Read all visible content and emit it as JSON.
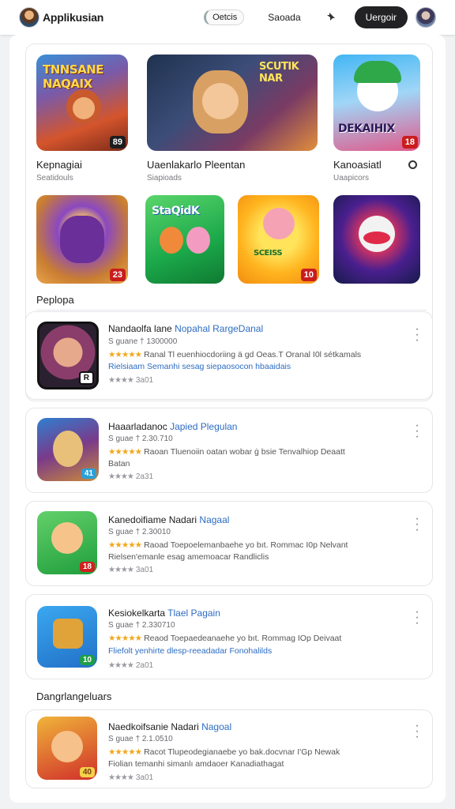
{
  "header": {
    "app_name": "Applikusian",
    "pill_label": "Oetcis",
    "link_label": "Saoada",
    "pin_icon": "pin-icon",
    "primary_label": "Uergoir"
  },
  "grid": {
    "row1": [
      {
        "title": "Kepnagiai",
        "subtitle": "Seatidouls",
        "badge": "89",
        "art_text": "TNNSANE NAQAIX"
      },
      {
        "title": "Uaenlakarlo Pleentan",
        "subtitle": "Siapioads",
        "badge": "",
        "art_text": "SCUTIK NAR"
      },
      {
        "title": "Kanoasiatl",
        "subtitle": "Uaapicors",
        "badge": "18",
        "art_text": "DEKAIHIX"
      }
    ],
    "row2_badges": [
      "23",
      "",
      "10",
      ""
    ],
    "row2_art": [
      "",
      "StaQidK",
      "SCEISS",
      ""
    ]
  },
  "section1_label": "Peplopa",
  "section2_label": "Dangrlangeluars",
  "list": [
    {
      "title": "Nandaolfa lane",
      "tag": "Nopahal RargeDanal",
      "meta": "S guane † 1300000",
      "desc": "Ranal Tl euenhiocdoriing ä gd Oeas.T Oranal I0l sétkamals",
      "desc2": "Rielsiaam Semanhi sesag siepaosocon hbaaidais",
      "rating": "3a01",
      "badge": "R"
    },
    {
      "title": "Haaarladanoc",
      "tag": "Japied Plegulan",
      "meta": "S guae † 2.30.710",
      "desc": "Raoan Tluenoiin oatan wobar ġ bsie Tenvalhiop Deaatt",
      "desc2": "Batan",
      "rating": "2a31",
      "badge": "41"
    },
    {
      "title": "Kanedoifiame Nadari",
      "tag": "Nagaal",
      "meta": "S guae † 2.30010",
      "desc": "Raoad Toepoelemanbaehe yo bıt. Rommac I0p Nelvant",
      "desc2": "Rielsen'emanle esag amemoacar Randliclis",
      "rating": "3a01",
      "badge": "18"
    },
    {
      "title": "Kesiokelkarta",
      "tag": "Tlael Pagain",
      "meta": "S guae † 2.330710",
      "desc": "Reaod Toepaedeanaehe yo bıt. Rommag IOp Deivaat",
      "desc2": "Fliefolt yenhirte dlesp-reeadadar Fonohalilds",
      "rating": "2a01",
      "badge": "10"
    },
    {
      "title": "Naedkoifsanie Nadari",
      "tag": "Nagoal",
      "meta": "S guae † 2.1.0510",
      "desc": "Racot Tlupeodegianaebe yo bak.docvnar I'Gp Newak",
      "desc2": "Fiolian temanhi simanlı amdaoer Kanadiathagat",
      "rating": "3a01",
      "badge": "40"
    }
  ]
}
